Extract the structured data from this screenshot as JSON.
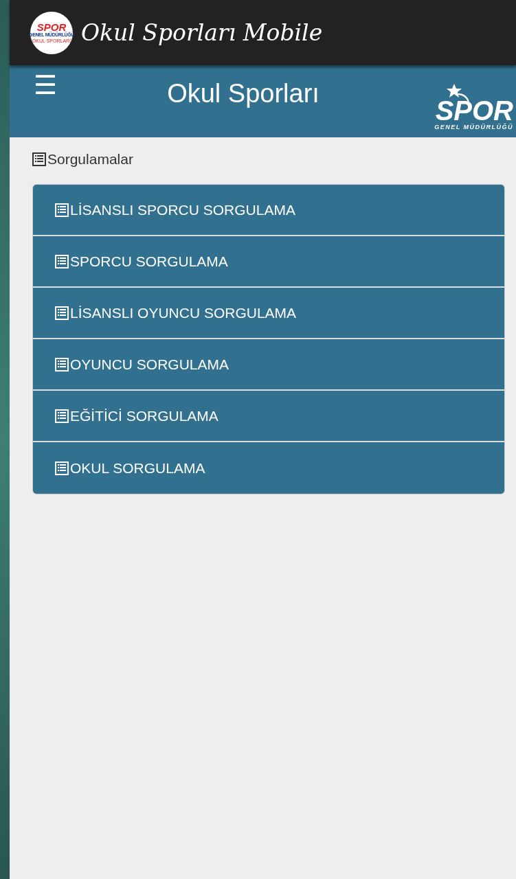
{
  "app_bar": {
    "logo": {
      "mark": "SPOR",
      "line_1": "GENEL MÜDÜRLÜĞÜ",
      "line_2": "OKUL SPORLARI"
    },
    "title": "Okul Sporları Mobile"
  },
  "header": {
    "menu_glyph": "☰",
    "title": "Okul Sporları",
    "logo": {
      "mark": "SPOR",
      "subtitle": "GENEL MÜDÜRLÜĞÜ"
    }
  },
  "section": {
    "title": "Sorgulamalar"
  },
  "menu_items": [
    {
      "label": "LİSANSLI SPORCU SORGULAMA"
    },
    {
      "label": "SPORCU SORGULAMA"
    },
    {
      "label": "LİSANSLI OYUNCU SORGULAMA"
    },
    {
      "label": "OYUNCU SORGULAMA"
    },
    {
      "label": "EĞİTİCİ SORGULAMA"
    },
    {
      "label": "OKUL SORGULAMA"
    }
  ]
}
